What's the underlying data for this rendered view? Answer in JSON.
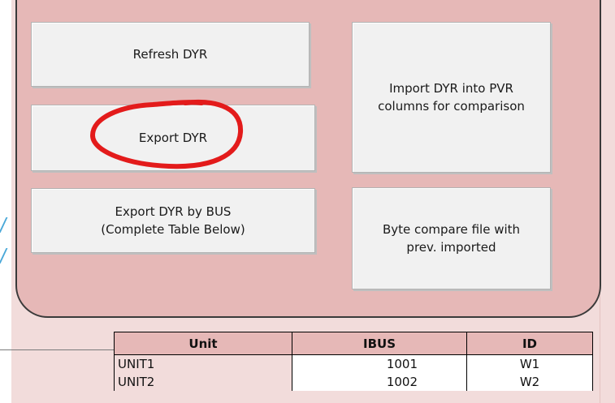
{
  "buttons": {
    "refresh": "Refresh DYR",
    "export": "Export DYR",
    "export_by_bus": "Export DYR by BUS\n(Complete Table Below)",
    "import": "Import DYR into PVR\ncolumns for comparison",
    "byte_compare": "Byte compare file with\nprev. imported"
  },
  "table": {
    "headers": [
      "Unit",
      "IBUS",
      "ID"
    ],
    "rows": [
      [
        "UNIT1",
        "1001",
        "W1"
      ],
      [
        "UNIT2",
        "1002",
        "W2"
      ]
    ]
  },
  "colors": {
    "panel": "#e6b8b7",
    "background": "#f2dcdb",
    "annotation": "#e31b1b",
    "blue_mark": "#4aa8d8"
  }
}
